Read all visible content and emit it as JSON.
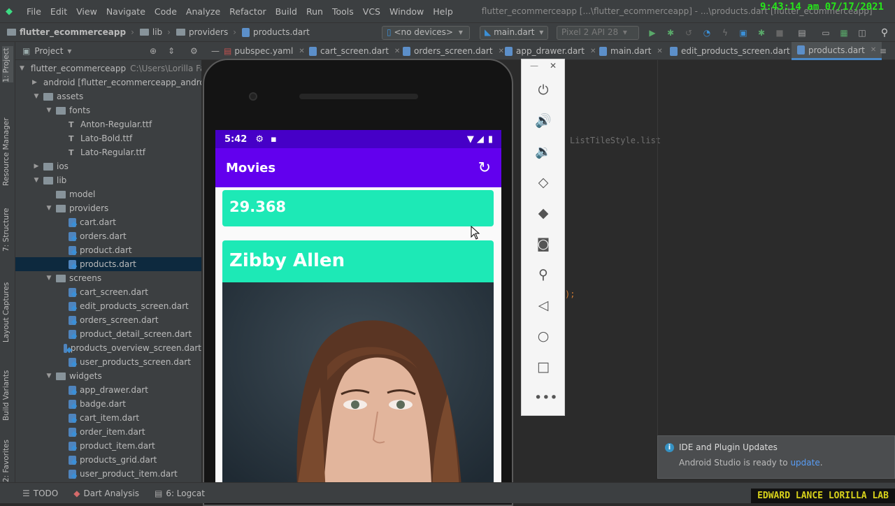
{
  "menu": {
    "items": [
      "File",
      "Edit",
      "View",
      "Navigate",
      "Code",
      "Analyze",
      "Refactor",
      "Build",
      "Run",
      "Tools",
      "VCS",
      "Window",
      "Help"
    ],
    "window_title": "flutter_ecommerceapp [...\\flutter_ecommerceapp] - ...\\products.dart [flutter_ecommerceapp]",
    "clock": "9:43:14 am 07/17/2021"
  },
  "nav": {
    "crumbs": [
      "flutter_ecommerceapp",
      "lib",
      "providers",
      "products.dart"
    ],
    "device_combo": "<no devices>",
    "run_config": "main.dart",
    "avd": "Pixel 2 API 28"
  },
  "left_stripe": {
    "tabs": [
      "1: Project",
      "Resource Manager",
      "7: Structure",
      "Layout Captures",
      "Build Variants",
      "2: Favorites"
    ]
  },
  "project": {
    "title": "Project",
    "tree": [
      {
        "label": "flutter_ecommerceapp",
        "suffix": "C:\\Users\\Lorilla Fam",
        "type": "folder",
        "arrow": "down",
        "indent": 0
      },
      {
        "label": "android [flutter_ecommerceapp_andro",
        "type": "folder",
        "arrow": "right",
        "indent": 1
      },
      {
        "label": "assets",
        "type": "folder",
        "arrow": "down",
        "indent": 1
      },
      {
        "label": "fonts",
        "type": "folder",
        "arrow": "down",
        "indent": 2
      },
      {
        "label": "Anton-Regular.ttf",
        "type": "text",
        "indent": 3
      },
      {
        "label": "Lato-Bold.ttf",
        "type": "text",
        "indent": 3
      },
      {
        "label": "Lato-Regular.ttf",
        "type": "text",
        "indent": 3
      },
      {
        "label": "ios",
        "type": "folder",
        "arrow": "right",
        "indent": 1
      },
      {
        "label": "lib",
        "type": "folder",
        "arrow": "down",
        "indent": 1
      },
      {
        "label": "model",
        "type": "folder",
        "indent": 2
      },
      {
        "label": "providers",
        "type": "folder",
        "arrow": "down",
        "indent": 2
      },
      {
        "label": "cart.dart",
        "type": "dart",
        "indent": 3
      },
      {
        "label": "orders.dart",
        "type": "dart",
        "indent": 3
      },
      {
        "label": "product.dart",
        "type": "dart",
        "indent": 3
      },
      {
        "label": "products.dart",
        "type": "dart",
        "indent": 3,
        "selected": true
      },
      {
        "label": "screens",
        "type": "folder",
        "arrow": "down",
        "indent": 2
      },
      {
        "label": "cart_screen.dart",
        "type": "dart",
        "indent": 3
      },
      {
        "label": "edit_products_screen.dart",
        "type": "dart",
        "indent": 3
      },
      {
        "label": "orders_screen.dart",
        "type": "dart",
        "indent": 3
      },
      {
        "label": "product_detail_screen.dart",
        "type": "dart",
        "indent": 3
      },
      {
        "label": "products_overview_screen.dart",
        "type": "dart",
        "indent": 3
      },
      {
        "label": "user_products_screen.dart",
        "type": "dart",
        "indent": 3
      },
      {
        "label": "widgets",
        "type": "folder",
        "arrow": "down",
        "indent": 2
      },
      {
        "label": "app_drawer.dart",
        "type": "dart",
        "indent": 3
      },
      {
        "label": "badge.dart",
        "type": "dart",
        "indent": 3
      },
      {
        "label": "cart_item.dart",
        "type": "dart",
        "indent": 3
      },
      {
        "label": "order_item.dart",
        "type": "dart",
        "indent": 3
      },
      {
        "label": "product_item.dart",
        "type": "dart",
        "indent": 3
      },
      {
        "label": "products_grid.dart",
        "type": "dart",
        "indent": 3
      },
      {
        "label": "user_product_item.dart",
        "type": "dart",
        "indent": 3
      }
    ]
  },
  "tabs": [
    "pubspec.yaml",
    "cart_screen.dart",
    "orders_screen.dart",
    "app_drawer.dart",
    "main.dart",
    "edit_products_screen.dart",
    "products.dart"
  ],
  "active_tab": "products.dart",
  "editor": {
    "line1": "ListTileStyle.list",
    "line2": ");"
  },
  "emulator": {
    "status_time": "5:42",
    "app_title": "Movies",
    "rating": "29.368",
    "name": "Zibby Allen",
    "accent": "#6200ee",
    "card_color": "#1de9b6"
  },
  "notification": {
    "title": "IDE and Plugin Updates",
    "body": "Android Studio is ready to ",
    "link": "update",
    "tail": "."
  },
  "bottom": {
    "todo": "TODO",
    "dart_analysis": "Dart Analysis",
    "logcat": "6: Logcat"
  },
  "watermark": "EDWARD LANCE LORILLA LAB"
}
